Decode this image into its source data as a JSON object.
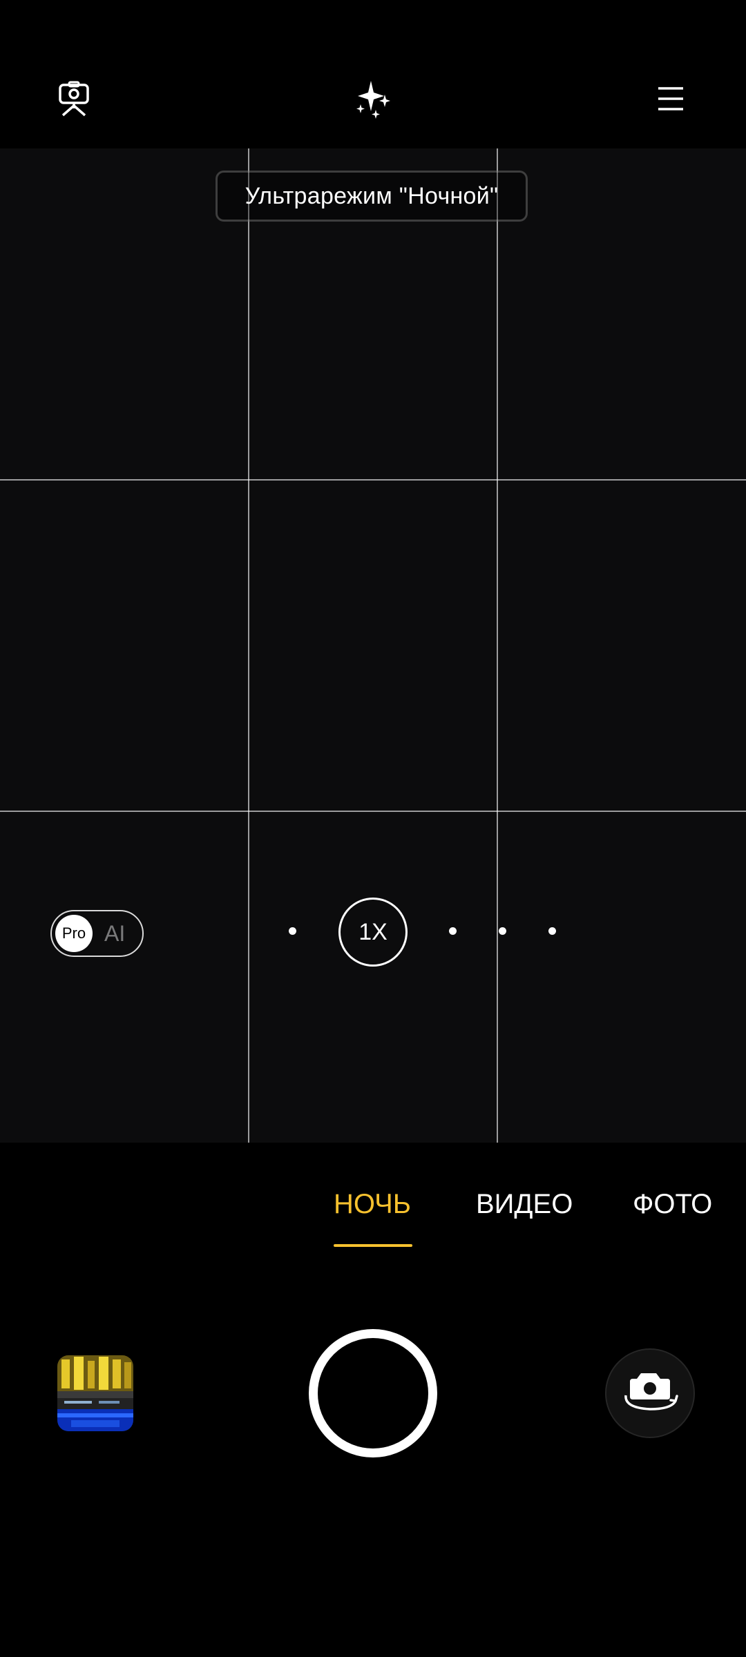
{
  "top_bar": {
    "icons": [
      "camera-settings-icon",
      "ai-sparkle-icon",
      "menu-icon"
    ]
  },
  "viewfinder": {
    "mode_badge": "Ультрарежим \"Ночной\"",
    "grid": "3x3",
    "pro_ai_toggle": {
      "pro_label": "Pro",
      "ai_label": "AI"
    },
    "zoom": {
      "current": "1X"
    }
  },
  "mode_tabs": {
    "items": [
      {
        "label": "НОЧЬ",
        "active": true
      },
      {
        "label": "ВИДЕО",
        "active": false
      },
      {
        "label": "ФОТО",
        "active": false
      }
    ]
  },
  "bottom_bar": {
    "gallery_icon": "gallery-thumbnail",
    "shutter_icon": "shutter-button",
    "switch_icon": "switch-camera-icon"
  },
  "colors": {
    "accent": "#f7c12e",
    "background": "#000000",
    "viewfinder": "#0c0c0d"
  }
}
